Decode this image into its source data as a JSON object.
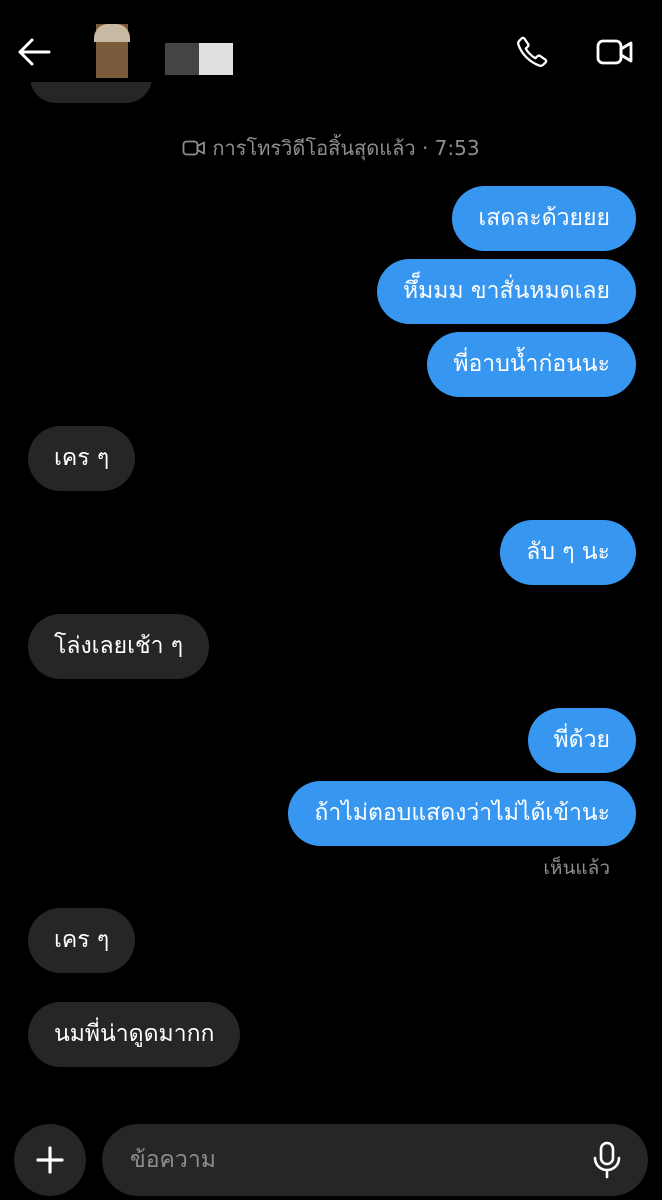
{
  "header": {
    "back_icon": "arrow-left-icon",
    "call_icon": "phone-icon",
    "video_icon": "video-camera-icon"
  },
  "system_message": {
    "icon": "video-camera-icon",
    "text": "การโทรวิดีโอสิ้นสุดแล้ว · 7:53"
  },
  "messages": [
    {
      "direction": "out",
      "text": "เสดละด้วยยย"
    },
    {
      "direction": "out",
      "text": "หึ็มมม ขาสั่นหมดเลย"
    },
    {
      "direction": "out",
      "text": "พี่อาบน้ำก่อนนะ"
    },
    {
      "direction": "in",
      "text": "เคร ๆ"
    },
    {
      "direction": "out",
      "text": "ลับ ๆ นะ"
    },
    {
      "direction": "in",
      "text": "โล่งเลยเช้า ๆ"
    },
    {
      "direction": "out",
      "text": "พี่ด้วย"
    },
    {
      "direction": "out",
      "text": "ถ้าไม่ตอบแสดงว่าไม่ได้เข้านะ"
    },
    {
      "direction": "in",
      "text": "เคร ๆ"
    },
    {
      "direction": "in",
      "text": "นมพี่น่าดูดมากก"
    }
  ],
  "seen_label": "เห็นแล้ว",
  "composer": {
    "placeholder": "ข้อความ",
    "plus_icon": "plus-icon",
    "mic_icon": "microphone-icon"
  },
  "colors": {
    "background": "#000000",
    "outgoing_bubble": "#3797f0",
    "incoming_bubble": "#262626",
    "muted_text": "#8e8e8e"
  }
}
